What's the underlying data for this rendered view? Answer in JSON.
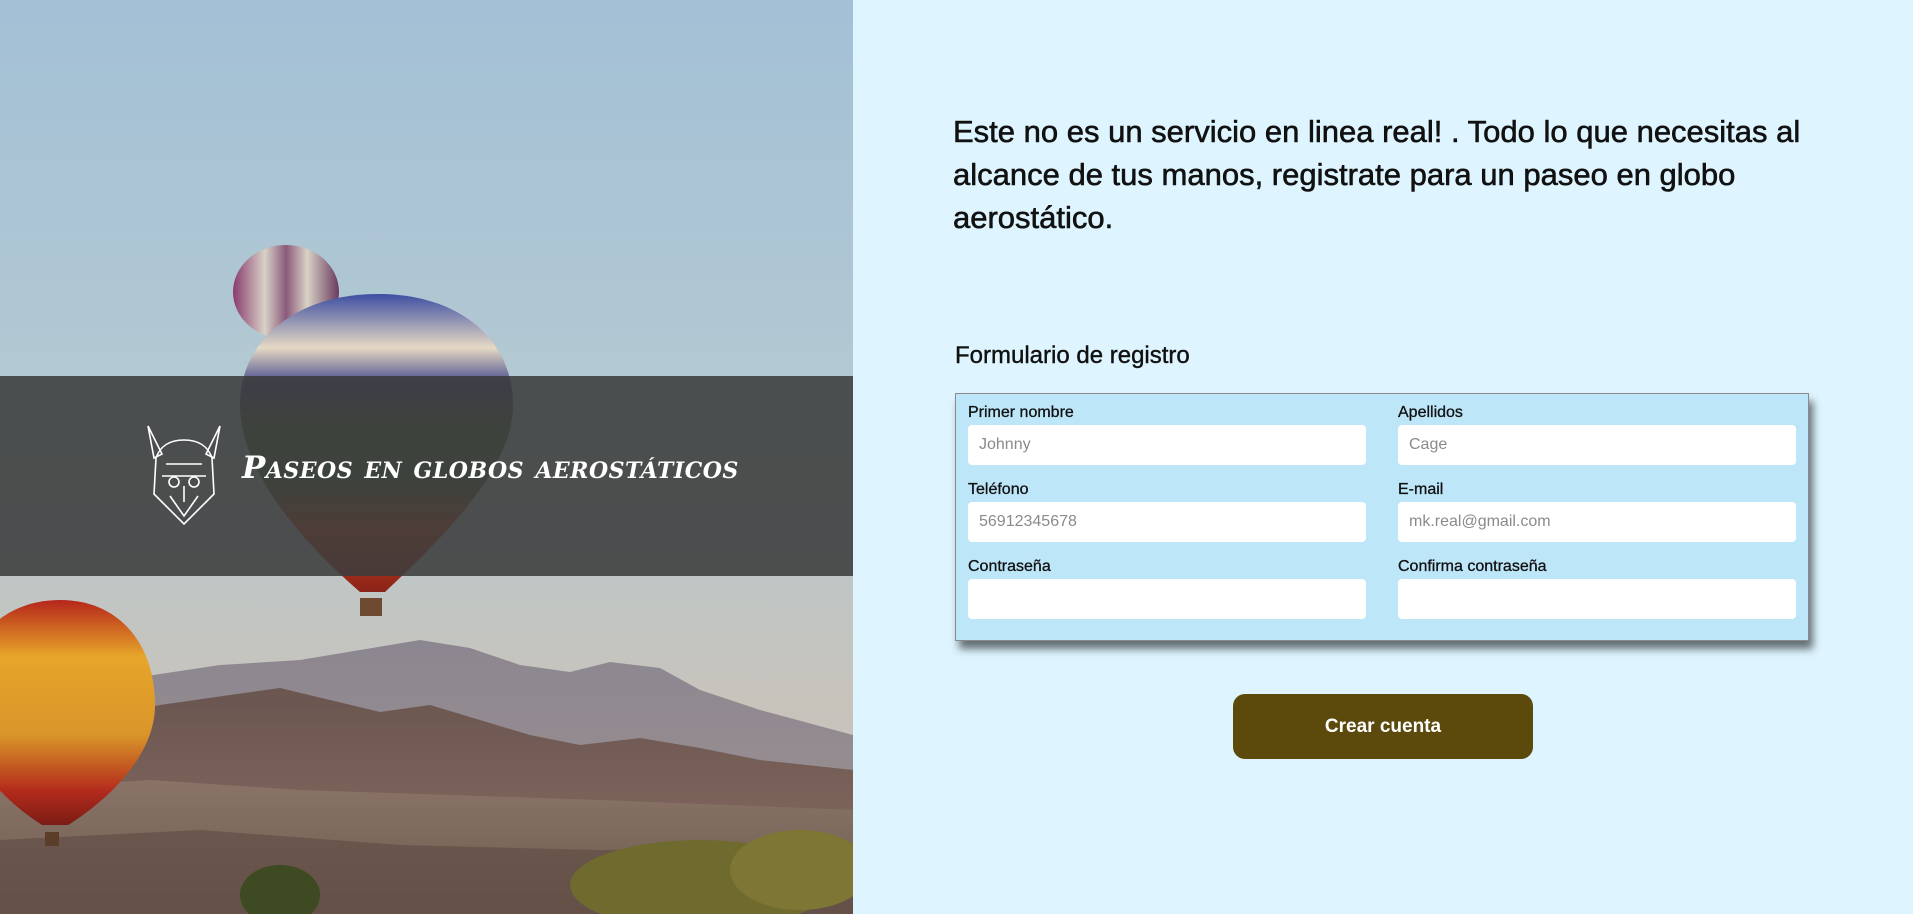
{
  "hero": {
    "brand_name": "Paseos en globos aerostáticos",
    "logo_icon": "viking-helmet-icon"
  },
  "intro": {
    "text": "Este no es un servicio en linea real! . Todo lo que necesitas al alcance de tus manos, registrate para un paseo en globo aerostático."
  },
  "form": {
    "title": "Formulario de registro",
    "fields": {
      "first_name": {
        "label": "Primer nombre",
        "placeholder": "Johnny",
        "value": ""
      },
      "last_name": {
        "label": "Apellidos",
        "placeholder": "Cage",
        "value": ""
      },
      "phone": {
        "label": "Teléfono",
        "placeholder": "56912345678",
        "value": ""
      },
      "email": {
        "label": "E-mail",
        "placeholder": "mk.real@gmail.com",
        "value": ""
      },
      "password": {
        "label": "Contraseña",
        "placeholder": "",
        "value": ""
      },
      "confirm_password": {
        "label": "Confirma contraseña",
        "placeholder": "",
        "value": ""
      }
    },
    "submit_label": "Crear cuenta"
  },
  "colors": {
    "panel_bg": "#def5ff",
    "form_bg": "#bde6f8",
    "button_bg": "#5b4a0c",
    "hero_band": "#3c3c3c"
  }
}
